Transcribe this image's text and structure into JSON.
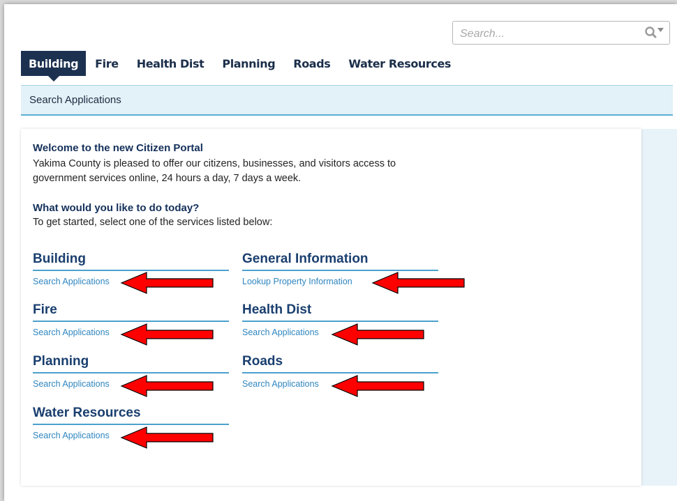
{
  "search": {
    "placeholder": "Search..."
  },
  "tabs": [
    {
      "label": "Building",
      "active": true
    },
    {
      "label": "Fire"
    },
    {
      "label": "Health Dist"
    },
    {
      "label": "Planning"
    },
    {
      "label": "Roads"
    },
    {
      "label": "Water Resources"
    }
  ],
  "subnav": {
    "label": "Search Applications"
  },
  "welcome": {
    "title": "Welcome to the new Citizen Portal",
    "line1": "Yakima County is pleased to offer our citizens, businesses, and visitors access to",
    "line2": "government services online, 24 hours a day, 7 days a week."
  },
  "todo": {
    "title": "What would you like to do today?",
    "text": "To get started, select one of the services listed below:"
  },
  "services": [
    {
      "title": "Building",
      "link": "Search Applications"
    },
    {
      "title": "General Information",
      "link": "Lookup Property Information"
    },
    {
      "title": "Fire",
      "link": "Search Applications"
    },
    {
      "title": "Health Dist",
      "link": "Search Applications"
    },
    {
      "title": "Planning",
      "link": "Search Applications"
    },
    {
      "title": "Roads",
      "link": "Search Applications"
    },
    {
      "title": "Water Resources",
      "link": "Search Applications"
    }
  ],
  "colors": {
    "arrow": "#ff0000",
    "tab_active_bg": "#1c3150",
    "link": "#2f86c0",
    "heading": "#1a3f6f"
  },
  "icons": {
    "search": "search-icon",
    "dropdown": "caret-down-icon",
    "annotation": "red-arrow-icon"
  }
}
